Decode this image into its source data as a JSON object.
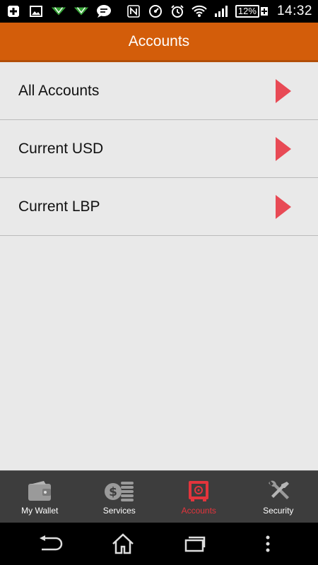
{
  "status_bar": {
    "battery": "12%",
    "time": "14:32",
    "icons_left": [
      "add-box-icon",
      "image-icon",
      "signal-arrow-icon",
      "signal-arrow-icon",
      "chat-bubble-icon"
    ],
    "icons_right": [
      "nfc-icon",
      "speedometer-icon",
      "alarm-icon",
      "wifi-icon",
      "cell-signal-icon",
      "battery-icon"
    ]
  },
  "header": {
    "title": "Accounts"
  },
  "accounts": {
    "items": [
      {
        "label": "All Accounts"
      },
      {
        "label": "Current USD"
      },
      {
        "label": "Current LBP"
      }
    ]
  },
  "bottom_nav": {
    "items": [
      {
        "label": "My Wallet",
        "icon": "wallet-icon",
        "active": false
      },
      {
        "label": "Services",
        "icon": "coins-icon",
        "active": false
      },
      {
        "label": "Accounts",
        "icon": "safe-icon",
        "active": true
      },
      {
        "label": "Security",
        "icon": "tools-icon",
        "active": false
      }
    ]
  },
  "colors": {
    "header_bg": "#d35d0a",
    "arrow": "#e84a55",
    "active_tab": "#e3343c",
    "nav_bg": "#3d3d3d",
    "content_bg": "#e9e9e9"
  }
}
